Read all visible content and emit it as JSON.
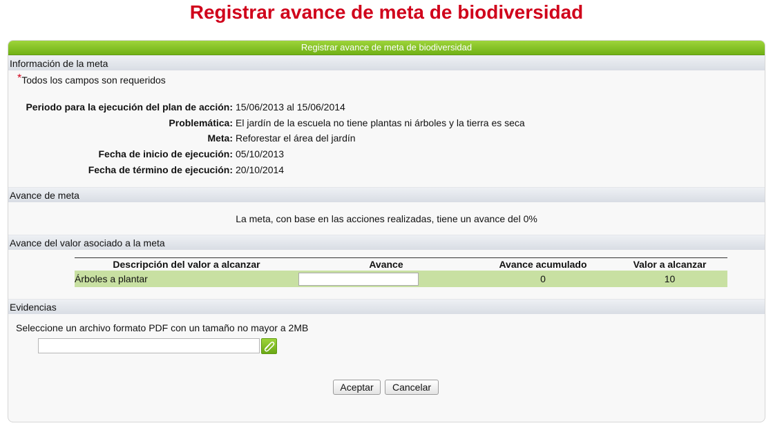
{
  "page_title": "Registrar avance de meta de biodiversidad",
  "panel": {
    "header": "Registrar avance de meta de biodiversidad"
  },
  "info_section": {
    "title": "Información de la meta",
    "required_note": "Todos los campos son requeridos",
    "rows": [
      {
        "label": "Periodo para la ejecución del plan de acción:",
        "value": "15/06/2013 al 15/06/2014"
      },
      {
        "label": "Problemática:",
        "value": "El jardín de la escuela no tiene plantas ni árboles y la tierra es seca"
      },
      {
        "label": "Meta:",
        "value": "Reforestar el área del jardín"
      },
      {
        "label": "Fecha de inicio de ejecución:",
        "value": "05/10/2013"
      },
      {
        "label": "Fecha de término de ejecución:",
        "value": "20/10/2014"
      }
    ]
  },
  "progress_section": {
    "title": "Avance de meta",
    "text": "La meta, con base en las acciones realizadas, tiene un avance del 0%"
  },
  "value_section": {
    "title": "Avance del valor asociado a la meta",
    "columns": [
      "Descripción del valor a alcanzar",
      "Avance",
      "Avance acumulado",
      "Valor a alcanzar"
    ],
    "rows": [
      {
        "description": "Árboles a plantar",
        "avance": "",
        "accumulated": "0",
        "target": "10"
      }
    ]
  },
  "evidence_section": {
    "title": "Evidencias",
    "instruction": "Seleccione un archivo formato PDF con un tamaño no mayor a 2MB",
    "file_value": "",
    "attach_icon": "paperclip-icon"
  },
  "buttons": {
    "accept": "Aceptar",
    "cancel": "Cancelar"
  },
  "colors": {
    "title_red": "#d0021b",
    "header_green": "#70b116",
    "row_green": "#c8e0a2"
  }
}
